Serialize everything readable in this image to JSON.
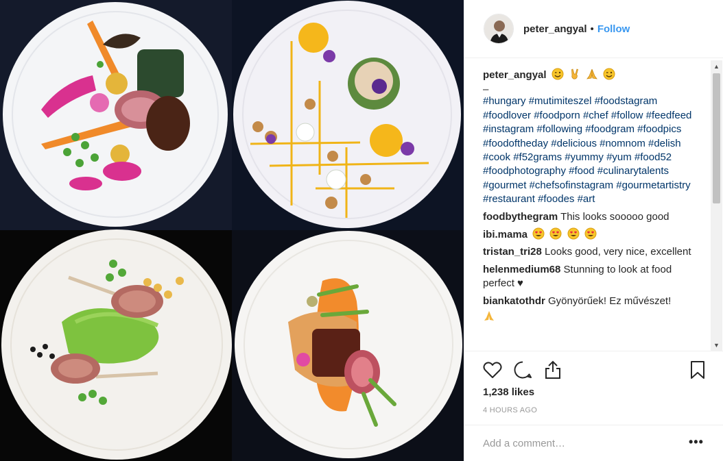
{
  "post": {
    "username": "peter_angyal",
    "separator": "•",
    "follow_label": "Follow",
    "avatar_icon": "chef-portrait-avatar",
    "photo_description_icon": "food-plates-photo"
  },
  "caption": {
    "username": "peter_angyal",
    "emojis": [
      "winking-face-icon",
      "victory-hand-icon",
      "folded-hands-icon",
      "winking-face-icon"
    ],
    "dash": "–",
    "hashtags": "#hungary #mutimiteszel #foodstagram #foodlover #foodporn #chef #follow #feedfeed #instagram #following #foodgram #foodpics #foodoftheday #delicious #nomnom #delish #cook #f52grams #yummy #yum #food52 #foodphotography #food #culinarytalents #gourmet #chefsofinstagram #gourmetartistry #restaurant #foodes #art"
  },
  "comments": [
    {
      "user": "foodbythegram",
      "text": "This looks sooooo good"
    },
    {
      "user": "ibi.mama",
      "text": "",
      "emojis": [
        "heart-eyes-icon",
        "heart-eyes-icon",
        "heart-eyes-icon",
        "heart-eyes-icon"
      ]
    },
    {
      "user": "tristan_tri28",
      "text": "Looks good, very nice, excellent"
    },
    {
      "user": "helenmedium68",
      "text": "Stunning to look at food perfect ♥"
    },
    {
      "user": "biankatothdr",
      "text": "Gyönyörűek! Ez művészet!"
    }
  ],
  "actions": {
    "like_icon": "heart-icon",
    "comment_icon": "comment-bubble-icon",
    "share_icon": "share-icon",
    "save_icon": "bookmark-icon"
  },
  "likes_text": "1,238 likes",
  "time_text": "4 HOURS AGO",
  "add_comment": {
    "placeholder": "Add a comment…",
    "more_label": "•••"
  },
  "colors": {
    "link": "#3897f0",
    "hashtag": "#003569",
    "photo_bg": "#0f1422"
  }
}
